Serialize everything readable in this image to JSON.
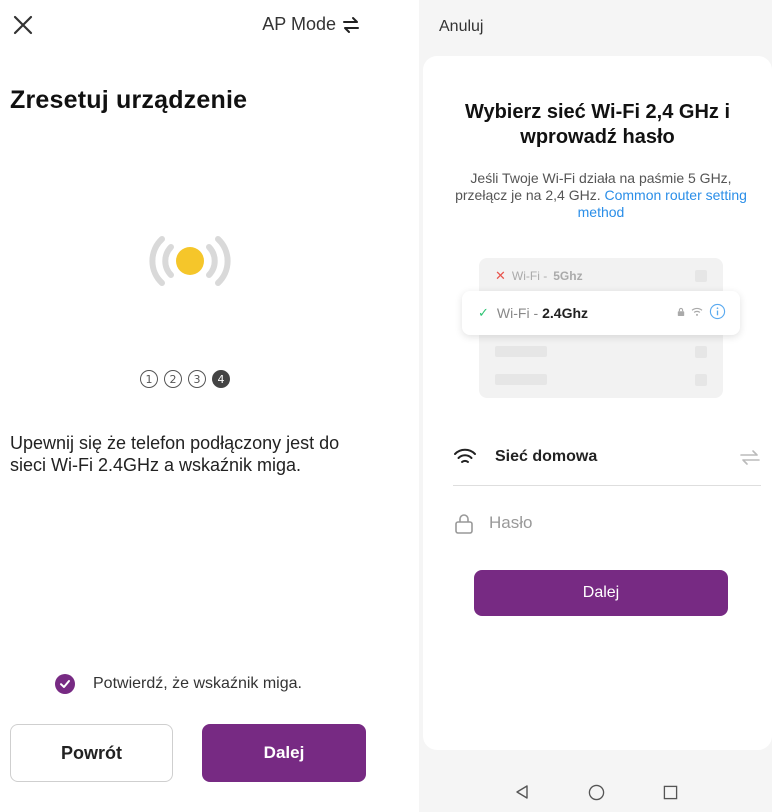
{
  "left_screen": {
    "ap_mode_label": "AP Mode",
    "title": "Zresetuj urządzenie",
    "steps": [
      "1",
      "2",
      "3",
      "4"
    ],
    "active_step": 4,
    "instruction": "Upewnij się że telefon podłączony jest do sieci Wi-Fi 2.4GHz a wskaźnik miga.",
    "confirm_label": "Potwierdź, że wskaźnik miga.",
    "confirm_checked": true,
    "back_label": "Powrót",
    "next_label": "Dalej"
  },
  "right_screen": {
    "cancel_label": "Anuluj",
    "title": "Wybierz sieć Wi-Fi 2,4 GHz i wprowadź hasło",
    "subtitle": "Jeśli Twoje Wi-Fi działa na paśmie 5 GHz, przełącz je na 2,4 GHz.",
    "router_link": "Common router setting method",
    "wifi_5g_prefix": "Wi-Fi -",
    "wifi_5g_band": "5Ghz",
    "wifi_24_prefix": "Wi-Fi -",
    "wifi_24_band": "2.4Ghz",
    "network_name": "Sieć domowa",
    "password_placeholder": "Hasło",
    "next_label": "Dalej"
  },
  "colors": {
    "accent": "#772a83",
    "link": "#2a8ee8",
    "indicator": "#f5c62a",
    "check_green": "#2fc474",
    "error_red": "#e8554e"
  },
  "icons": {
    "close": "close-icon",
    "ap_mode": "swap-arrows-icon",
    "indicator": "blinking-light-icon",
    "confirm": "checkmark-circle-icon",
    "network": "wifi-icon",
    "switch": "swap-arrows-icon",
    "password": "lock-icon",
    "nav_back": "triangle-back-icon",
    "nav_home": "circle-home-icon",
    "nav_recents": "square-recents-icon"
  }
}
